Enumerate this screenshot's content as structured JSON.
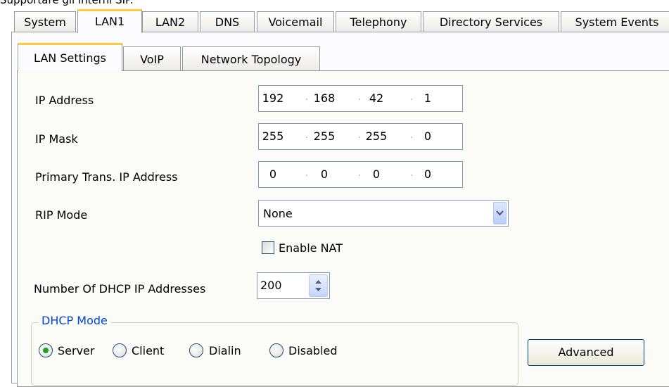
{
  "top_note": "Supportare gli interni SIP.",
  "outer_tabs": [
    {
      "label": "System"
    },
    {
      "label": "LAN1",
      "active": true
    },
    {
      "label": "LAN2"
    },
    {
      "label": "DNS"
    },
    {
      "label": "Voicemail"
    },
    {
      "label": "Telephony"
    },
    {
      "label": "Directory Services"
    },
    {
      "label": "System Events"
    }
  ],
  "inner_tabs": [
    {
      "label": "LAN Settings",
      "active": true
    },
    {
      "label": "VoIP"
    },
    {
      "label": "Network Topology"
    }
  ],
  "form": {
    "ip_address": {
      "label": "IP Address",
      "octets": [
        "192",
        "168",
        "42",
        "1"
      ]
    },
    "ip_mask": {
      "label": "IP Mask",
      "octets": [
        "255",
        "255",
        "255",
        "0"
      ]
    },
    "primary_trans": {
      "label": "Primary Trans. IP Address",
      "octets": [
        "0",
        "0",
        "0",
        "0"
      ]
    },
    "rip_mode": {
      "label": "RIP Mode",
      "value": "None"
    },
    "enable_nat": {
      "label": "Enable NAT",
      "checked": false
    },
    "dhcp_count": {
      "label": "Number Of DHCP IP Addresses",
      "value": "200"
    }
  },
  "dhcp_mode": {
    "title": "DHCP Mode",
    "options": [
      "Server",
      "Client",
      "Dialin",
      "Disabled"
    ],
    "selected": "Server"
  },
  "advanced_button": "Advanced",
  "colors": {
    "tab_highlight": "#ffc83c",
    "group_title": "#0046d5",
    "radio_selected": "#21a121",
    "field_border": "#7f9db9"
  }
}
